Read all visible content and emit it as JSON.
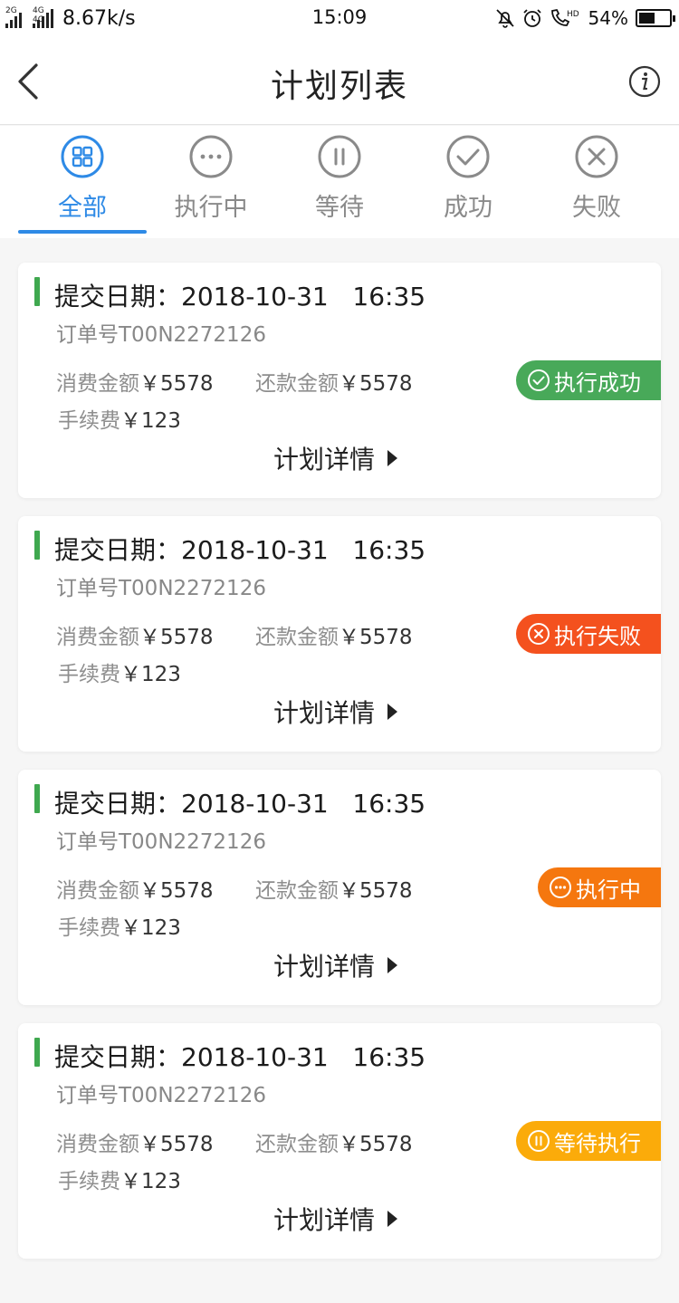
{
  "status_bar": {
    "network_1": "2G",
    "network_2": "4G 4G",
    "speed": "8.67k/s",
    "time": "15:09",
    "battery": "54%",
    "battery_level": 0.54
  },
  "header": {
    "title": "计划列表"
  },
  "tabs": [
    {
      "label": "全部",
      "icon": "grid-icon",
      "active": true
    },
    {
      "label": "执行中",
      "icon": "ellipsis-circle-icon",
      "active": false
    },
    {
      "label": "等待",
      "icon": "pause-circle-icon",
      "active": false
    },
    {
      "label": "成功",
      "icon": "check-circle-icon",
      "active": false
    },
    {
      "label": "失败",
      "icon": "x-circle-icon",
      "active": false
    }
  ],
  "plans": [
    {
      "date": "提交日期：2018-10-31   16:35",
      "order": "订单号T00N2272126",
      "spend_label": "消费金额",
      "spend_amount": "￥5578",
      "repay_label": "还款金额",
      "repay_amount": "￥5578",
      "fee_label": "手续费",
      "fee_amount": "￥123",
      "detail": "计划详情",
      "status": "执行成功",
      "status_icon": "check-circle-icon",
      "status_color": "#48a959"
    },
    {
      "date": "提交日期：2018-10-31   16:35",
      "order": "订单号T00N2272126",
      "spend_label": "消费金额",
      "spend_amount": "￥5578",
      "repay_label": "还款金额",
      "repay_amount": "￥5578",
      "fee_label": "手续费",
      "fee_amount": "￥123",
      "detail": "计划详情",
      "status": "执行失败",
      "status_icon": "x-circle-icon",
      "status_color": "#f4511e"
    },
    {
      "date": "提交日期：2018-10-31   16:35",
      "order": "订单号T00N2272126",
      "spend_label": "消费金额",
      "spend_amount": "￥5578",
      "repay_label": "还款金额",
      "repay_amount": "￥5578",
      "fee_label": "手续费",
      "fee_amount": "￥123",
      "detail": "计划详情",
      "status": "执行中",
      "status_icon": "ellipsis-circle-icon",
      "status_color": "#f5770f"
    },
    {
      "date": "提交日期：2018-10-31   16:35",
      "order": "订单号T00N2272126",
      "spend_label": "消费金额",
      "spend_amount": "￥5578",
      "repay_label": "还款金额",
      "repay_amount": "￥5578",
      "fee_label": "手续费",
      "fee_amount": "￥123",
      "detail": "计划详情",
      "status": "等待执行",
      "status_icon": "pause-circle-icon",
      "status_color": "#fbab0a"
    }
  ],
  "colors": {
    "accent": "#2e8ae6",
    "date_marker": "#3fa84f",
    "inactive_tab": "#8a8a8a"
  }
}
